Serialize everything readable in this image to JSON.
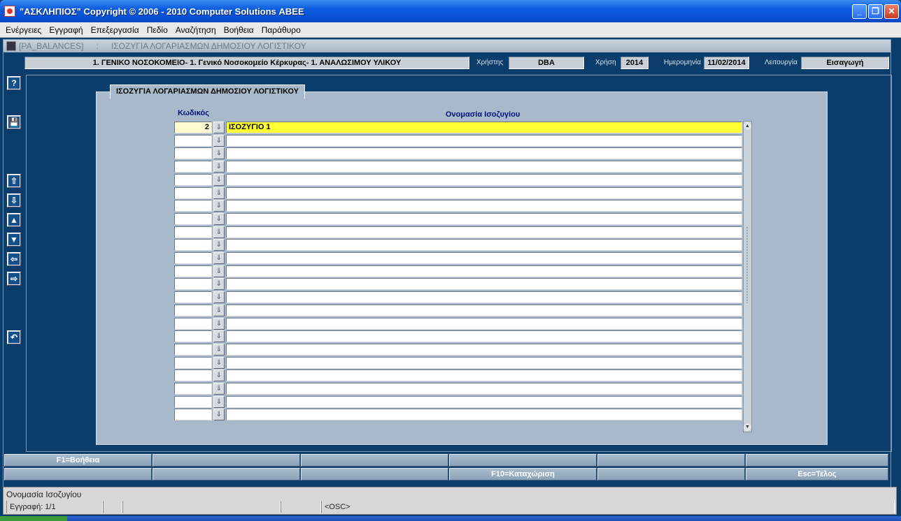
{
  "window": {
    "title": "\"ΑΣΚΛΗΠΙΟΣ\" Copyright © 2006 - 2010 Computer Solutions ΑΒΕΕ",
    "controls": [
      "_",
      "❐",
      "✕"
    ]
  },
  "menu": [
    "Ενέργειες",
    "Εγγραφή",
    "Επεξεργασία",
    "Πεδίο",
    "Αναζήτηση",
    "Βοήθεια",
    "Παράθυρο"
  ],
  "form": {
    "code": "[PA_BALANCES]",
    "separator": ":",
    "name": "ΙΣΟΖΥΓΙΑ ΛΟΓΑΡΙΑΣΜΩΝ ΔΗΜΟΣΙΟΥ ΛΟΓΙΣΤΙΚΟΥ"
  },
  "info": {
    "organization": "1. ΓΕΝΙΚΟ ΝΟΣΟΚΟΜΕΙΟ- 1. Γενικό Νοσοκομείο Κέρκυρας- 1. ΑΝΑΛΩΣΙΜΟΥ ΥΛΙΚΟΥ",
    "user_label": "Χρήστης",
    "user": "DBA",
    "year_label": "Χρήση",
    "year": "2014",
    "date_label": "Ημερομηνία",
    "date": "11/02/2014",
    "mode_label": "Λειτουργία",
    "mode": "Εισαγωγή"
  },
  "toolbar": {
    "help": "?",
    "save": "💾",
    "first": "⇧",
    "last": "⇩",
    "prev": "▲",
    "next": "▼",
    "left": "⇦",
    "right": "⇨",
    "undo": "↶"
  },
  "panel": {
    "title": "ΙΣΟΖΥΓΙΑ ΛΟΓΑΡΙΑΣΜΩΝ ΔΗΜΟΣΙΟΥ ΛΟΓΙΣΤΙΚΟΥ",
    "col_code": "Κωδικός",
    "col_name": "Ονομασία Ισοζυγίου",
    "rows": [
      {
        "code": "2",
        "name": "ΙΣΟΖΥΓΙΟ 1"
      },
      {
        "code": "",
        "name": ""
      },
      {
        "code": "",
        "name": ""
      },
      {
        "code": "",
        "name": ""
      },
      {
        "code": "",
        "name": ""
      },
      {
        "code": "",
        "name": ""
      },
      {
        "code": "",
        "name": ""
      },
      {
        "code": "",
        "name": ""
      },
      {
        "code": "",
        "name": ""
      },
      {
        "code": "",
        "name": ""
      },
      {
        "code": "",
        "name": ""
      },
      {
        "code": "",
        "name": ""
      },
      {
        "code": "",
        "name": ""
      },
      {
        "code": "",
        "name": ""
      },
      {
        "code": "",
        "name": ""
      },
      {
        "code": "",
        "name": ""
      },
      {
        "code": "",
        "name": ""
      },
      {
        "code": "",
        "name": ""
      },
      {
        "code": "",
        "name": ""
      },
      {
        "code": "",
        "name": ""
      },
      {
        "code": "",
        "name": ""
      },
      {
        "code": "",
        "name": ""
      },
      {
        "code": "",
        "name": ""
      }
    ]
  },
  "fkeys": {
    "row1": [
      "F1=Βοήθεια",
      "",
      "",
      "",
      "",
      ""
    ],
    "row2": [
      "",
      "",
      "",
      "F10=Καταχώριση",
      "",
      "Esc=Τέλος"
    ]
  },
  "status": {
    "message": "Ονομασία Ισοζυγίου",
    "record": "Εγγραφή: 1/1",
    "mode_osc": "<OSC>"
  }
}
